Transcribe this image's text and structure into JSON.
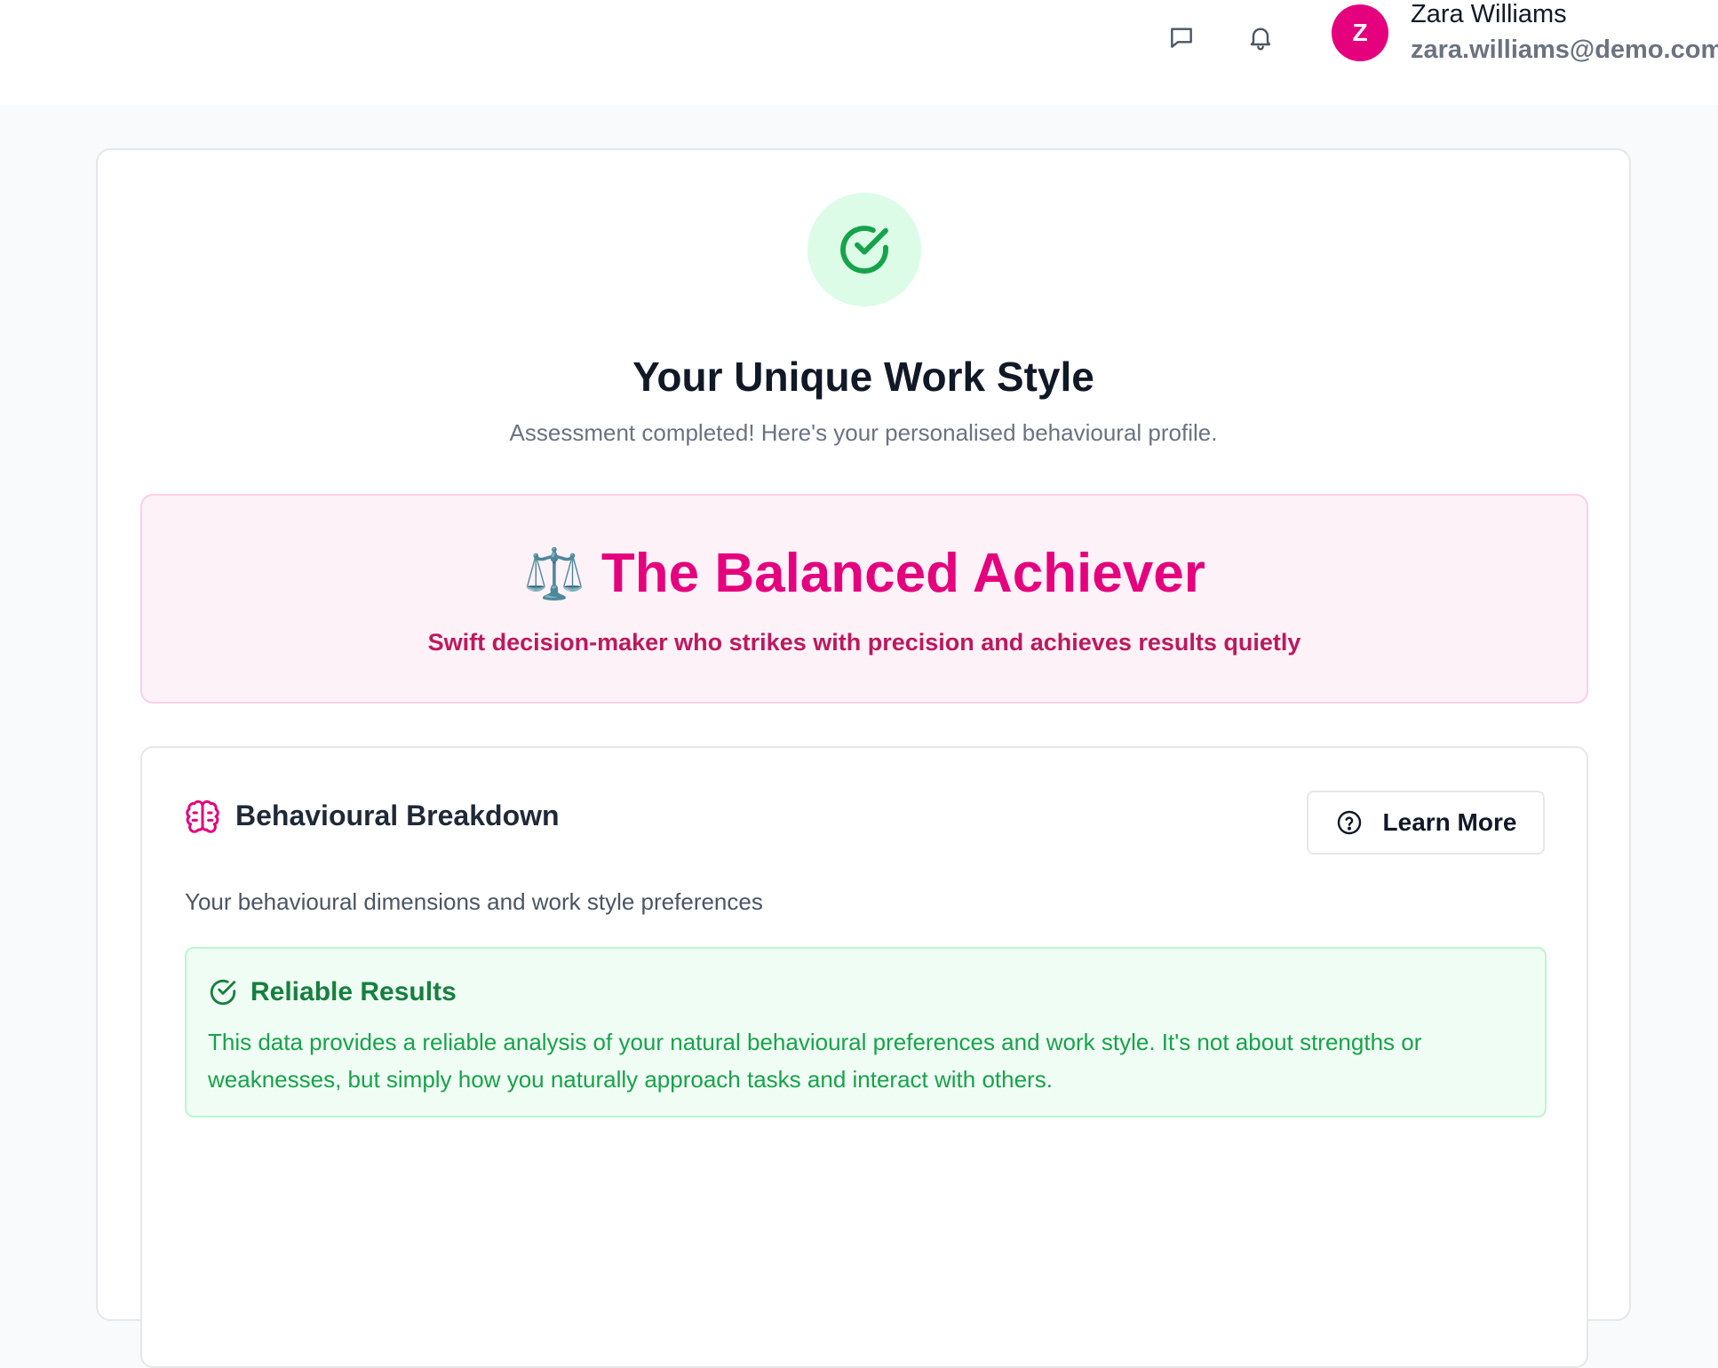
{
  "header": {
    "user": {
      "initial": "Z",
      "name": "Zara Williams",
      "email": "zara.williams@demo.com"
    },
    "icons": [
      "message-icon",
      "bell-icon"
    ]
  },
  "summary": {
    "title": "Your Unique Work Style",
    "subtitle": "Assessment completed! Here's your personalised behavioural profile."
  },
  "profile": {
    "emoji": "⚖️",
    "name": "The Balanced Achiever",
    "tagline": "Swift decision-maker who strikes with precision and achieves results quietly"
  },
  "breakdown": {
    "title": "Behavioural Breakdown",
    "learn_more_label": "Learn More",
    "description": "Your behavioural dimensions and work style preferences",
    "reliable": {
      "title": "Reliable Results",
      "text": "This data provides a reliable analysis of your natural behavioural preferences and work style. It's not about strengths or weaknesses, but simply how you naturally approach tasks and interact with others."
    }
  },
  "colors": {
    "brand": "#e5007d",
    "success": "#16a34a",
    "profile_bg": "#fdf2f8",
    "success_bg": "#f0fdf4"
  }
}
